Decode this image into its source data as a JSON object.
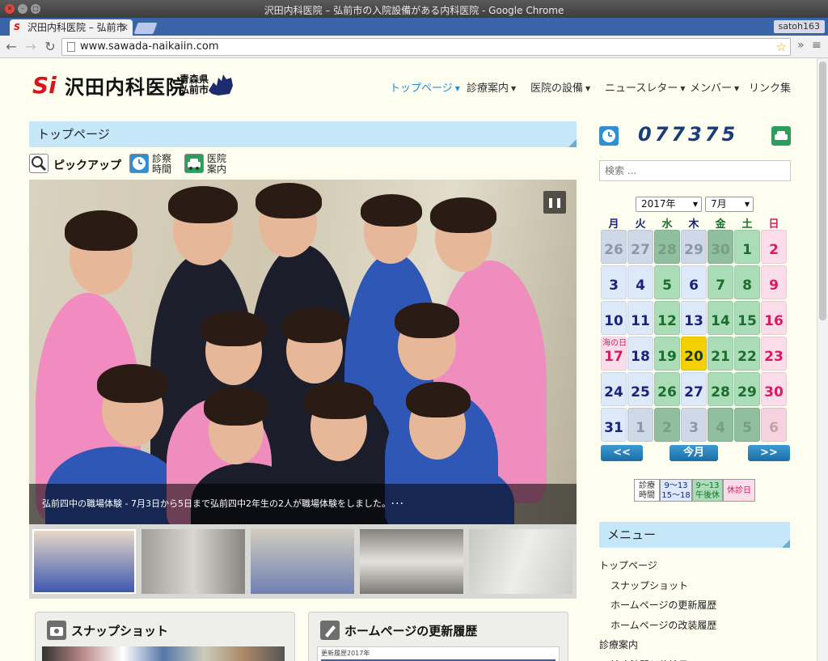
{
  "browser": {
    "window_title": "沢田内科医院 – 弘前市の入院設備がある内科医院 - Google Chrome",
    "tab_title": "沢田内科医院 – 弘前市",
    "user": "satoh163",
    "url": "www.sawada-naikaiin.com"
  },
  "site": {
    "logo_mark": "Si",
    "logo_text": "沢田内科医院",
    "logo_sub_1": "青森県",
    "logo_sub_2": "弘前市"
  },
  "nav": [
    {
      "label": "トップページ"
    },
    {
      "label": "診療案内"
    },
    {
      "label": "医院の設備"
    },
    {
      "label": "ニュースレター"
    },
    {
      "label": "メンバー"
    },
    {
      "label": "リンク集"
    }
  ],
  "main": {
    "section_title": "トップページ",
    "pickup_label": "ピックアップ",
    "hours_label_1": "診察",
    "hours_label_2": "時間",
    "guide_label_1": "医院",
    "guide_label_2": "案内",
    "caption": "弘前四中の職場体験 - 7月3日から5日まで弘前四中2年生の2人が職場体験をしました。･･･",
    "card_1_title": "スナップショット",
    "card_2_title": "ホームページの更新履歴",
    "card_2_snippet": "更新履歴2017年"
  },
  "sidebar": {
    "counter": "077375",
    "search_placeholder": "検索 ...",
    "year": "2017年",
    "month": "7月",
    "weekdays": [
      "月",
      "火",
      "水",
      "木",
      "金",
      "土",
      "日"
    ],
    "weekday_colors": [
      "#1a237e",
      "#1a237e",
      "#1b6e2c",
      "#1a237e",
      "#1b6e2c",
      "#1b6e2c",
      "#d81b60"
    ],
    "days": [
      {
        "n": "26",
        "k": "o"
      },
      {
        "n": "27",
        "k": "o"
      },
      {
        "n": "28",
        "k": "og"
      },
      {
        "n": "29",
        "k": "o"
      },
      {
        "n": "30",
        "k": "og"
      },
      {
        "n": "1",
        "k": "g"
      },
      {
        "n": "2",
        "k": "h"
      },
      {
        "n": "3",
        "k": "b"
      },
      {
        "n": "4",
        "k": "b"
      },
      {
        "n": "5",
        "k": "g"
      },
      {
        "n": "6",
        "k": "b"
      },
      {
        "n": "7",
        "k": "g"
      },
      {
        "n": "8",
        "k": "g"
      },
      {
        "n": "9",
        "k": "h"
      },
      {
        "n": "10",
        "k": "b"
      },
      {
        "n": "11",
        "k": "b"
      },
      {
        "n": "12",
        "k": "g"
      },
      {
        "n": "13",
        "k": "b"
      },
      {
        "n": "14",
        "k": "g"
      },
      {
        "n": "15",
        "k": "g"
      },
      {
        "n": "16",
        "k": "h"
      },
      {
        "n": "17",
        "k": "h",
        "note": "海の日"
      },
      {
        "n": "18",
        "k": "b"
      },
      {
        "n": "19",
        "k": "g"
      },
      {
        "n": "20",
        "k": "t"
      },
      {
        "n": "21",
        "k": "g"
      },
      {
        "n": "22",
        "k": "g"
      },
      {
        "n": "23",
        "k": "h"
      },
      {
        "n": "24",
        "k": "b"
      },
      {
        "n": "25",
        "k": "b"
      },
      {
        "n": "26",
        "k": "g"
      },
      {
        "n": "27",
        "k": "b"
      },
      {
        "n": "28",
        "k": "g"
      },
      {
        "n": "29",
        "k": "g"
      },
      {
        "n": "30",
        "k": "h"
      },
      {
        "n": "31",
        "k": "b"
      },
      {
        "n": "1",
        "k": "o"
      },
      {
        "n": "2",
        "k": "og"
      },
      {
        "n": "3",
        "k": "o"
      },
      {
        "n": "4",
        "k": "og"
      },
      {
        "n": "5",
        "k": "og"
      },
      {
        "n": "6",
        "k": "oh"
      }
    ],
    "prev_label": "<<",
    "today_label": "今月",
    "next_label": ">>",
    "legend": {
      "title_1": "診療",
      "title_2": "時間",
      "weekday_1": "9～13",
      "weekday_2": "15～18",
      "halfday_1": "9～13",
      "halfday_2": "午後休",
      "holiday": "休診日"
    },
    "menu_title": "メニュー",
    "menu": [
      {
        "label": "トップページ",
        "indent": 0
      },
      {
        "label": "スナップショット",
        "indent": 1
      },
      {
        "label": "ホームページの更新履歴",
        "indent": 1
      },
      {
        "label": "ホームページの改装履歴",
        "indent": 1
      },
      {
        "label": "診療案内",
        "indent": 0
      },
      {
        "label": "診療時間と休診日",
        "indent": 1
      }
    ]
  },
  "colors": {
    "accent": "#1f8dd6",
    "section_bg": "#c6e7f7",
    "cal_blue": "#dde9f8",
    "cal_green": "#a9dcb7",
    "cal_holiday": "#fbdde9",
    "cal_today": "#f5d000"
  }
}
